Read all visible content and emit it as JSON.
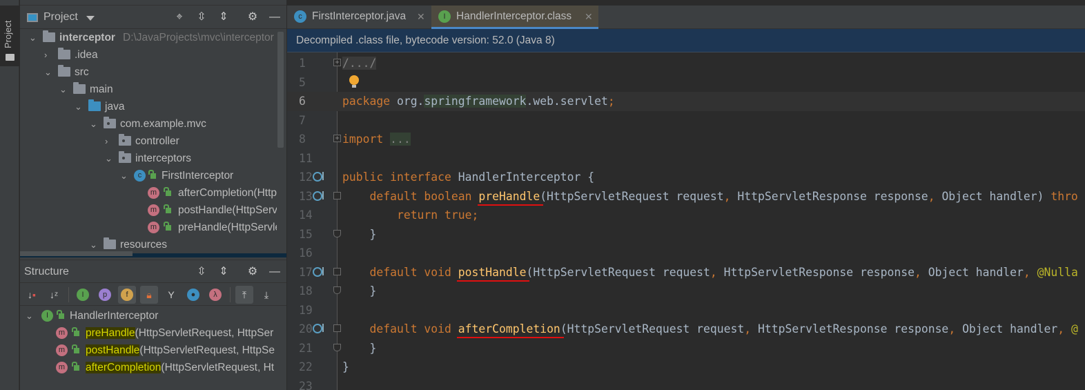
{
  "sidebar": {
    "tab_label": "Project"
  },
  "project_panel": {
    "title": "Project",
    "tree": [
      {
        "level": 0,
        "chev": "open",
        "icon": "module",
        "label": "interceptor",
        "bold": true,
        "path": "D:\\JavaProjects\\mvc\\interceptor"
      },
      {
        "level": 1,
        "chev": "closed",
        "icon": "folder",
        "label": ".idea"
      },
      {
        "level": 1,
        "chev": "open",
        "icon": "folder",
        "label": "src"
      },
      {
        "level": 2,
        "chev": "open",
        "icon": "folder",
        "label": "main"
      },
      {
        "level": 3,
        "chev": "open",
        "icon": "folder-blue",
        "label": "java"
      },
      {
        "level": 4,
        "chev": "open",
        "icon": "package",
        "label": "com.example.mvc"
      },
      {
        "level": 5,
        "chev": "closed",
        "icon": "package",
        "label": "controller"
      },
      {
        "level": 5,
        "chev": "open",
        "icon": "package",
        "label": "interceptors"
      },
      {
        "level": 6,
        "chev": "open",
        "icon": "class",
        "label": "FirstInterceptor"
      },
      {
        "level": 8,
        "chev": "none",
        "icon": "method",
        "label": "afterCompletion(Http"
      },
      {
        "level": 8,
        "chev": "none",
        "icon": "method",
        "label": "postHandle(HttpServ"
      },
      {
        "level": 8,
        "chev": "none",
        "icon": "method",
        "label": "preHandle(HttpServle"
      },
      {
        "level": 4,
        "chev": "open",
        "icon": "resources",
        "label": "resources"
      }
    ]
  },
  "structure_panel": {
    "title": "Structure",
    "root": "HandlerInterceptor",
    "items": [
      {
        "name": "preHandle",
        "rest": "(HttpServletRequest, HttpSer"
      },
      {
        "name": "postHandle",
        "rest": "(HttpServletRequest, HttpSe"
      },
      {
        "name": "afterCompletion",
        "rest": "(HttpServletRequest, Ht"
      }
    ]
  },
  "editor": {
    "tabs": [
      {
        "label": "FirstInterceptor.java",
        "icon": "class-icon",
        "active": false
      },
      {
        "label": "HandlerInterceptor.class",
        "icon": "interface-icon",
        "active": true
      }
    ],
    "banner": "Decompiled .class file, bytecode version: 52.0 (Java 8)",
    "current_line": "6",
    "lines": [
      {
        "n": "1",
        "fold": "+",
        "tokens": [
          [
            "cm",
            "/.../"
          ]
        ]
      },
      {
        "n": "5",
        "bulb": true,
        "tokens": []
      },
      {
        "n": "6",
        "tokens": [
          [
            "kw",
            "package "
          ],
          [
            "pl",
            "org."
          ],
          [
            "fd2",
            "springframework"
          ],
          [
            "pl",
            ".web.servlet"
          ],
          [
            "pu",
            ";"
          ]
        ]
      },
      {
        "n": "7",
        "tokens": []
      },
      {
        "n": "8",
        "fold": "+",
        "tokens": [
          [
            "kw",
            "import "
          ],
          [
            "fd",
            "..."
          ]
        ]
      },
      {
        "n": "11",
        "tokens": []
      },
      {
        "n": "12",
        "gutter": true,
        "tokens": [
          [
            "kw",
            "public interface "
          ],
          [
            "pl",
            "HandlerInterceptor {"
          ]
        ]
      },
      {
        "n": "13",
        "gutter": true,
        "fold": "-",
        "tokens": [
          [
            "pl",
            "    "
          ],
          [
            "kw",
            "default boolean "
          ],
          [
            "fn",
            "preHandle"
          ],
          [
            "pl",
            "(HttpServletRequest request"
          ],
          [
            "pu",
            ", "
          ],
          [
            "pl",
            "HttpServletResponse response"
          ],
          [
            "pu",
            ", "
          ],
          [
            "pl",
            "Object handler) "
          ],
          [
            "kw",
            "thro"
          ]
        ]
      },
      {
        "n": "14",
        "tokens": [
          [
            "pl",
            "        "
          ],
          [
            "kw",
            "return true"
          ],
          [
            "pu",
            ";"
          ]
        ]
      },
      {
        "n": "15",
        "fold": "e",
        "tokens": [
          [
            "pl",
            "    }"
          ]
        ]
      },
      {
        "n": "16",
        "tokens": []
      },
      {
        "n": "17",
        "gutter": true,
        "fold": "-",
        "tokens": [
          [
            "pl",
            "    "
          ],
          [
            "kw",
            "default void "
          ],
          [
            "fn",
            "postHandle"
          ],
          [
            "pl",
            "(HttpServletRequest request"
          ],
          [
            "pu",
            ", "
          ],
          [
            "pl",
            "HttpServletResponse response"
          ],
          [
            "pu",
            ", "
          ],
          [
            "pl",
            "Object handler"
          ],
          [
            "pu",
            ", "
          ],
          [
            "an",
            "@Nulla"
          ]
        ]
      },
      {
        "n": "18",
        "fold": "e",
        "tokens": [
          [
            "pl",
            "    }"
          ]
        ]
      },
      {
        "n": "19",
        "tokens": []
      },
      {
        "n": "20",
        "gutter": true,
        "fold": "-",
        "tokens": [
          [
            "pl",
            "    "
          ],
          [
            "kw",
            "default void "
          ],
          [
            "fn",
            "afterCompletion"
          ],
          [
            "pl",
            "(HttpServletRequest request"
          ],
          [
            "pu",
            ", "
          ],
          [
            "pl",
            "HttpServletResponse response"
          ],
          [
            "pu",
            ", "
          ],
          [
            "pl",
            "Object handler"
          ],
          [
            "pu",
            ", "
          ],
          [
            "an",
            "@"
          ]
        ]
      },
      {
        "n": "21",
        "fold": "e",
        "tokens": [
          [
            "pl",
            "    }"
          ]
        ]
      },
      {
        "n": "22",
        "tokens": [
          [
            "pl",
            "}"
          ]
        ]
      },
      {
        "n": "23",
        "tokens": []
      }
    ]
  },
  "colors": {
    "keyword": "#cc7832",
    "plain": "#a9b7c6",
    "annotation": "#bbb529",
    "underline": "#e01010",
    "banner": "#1d3653"
  }
}
